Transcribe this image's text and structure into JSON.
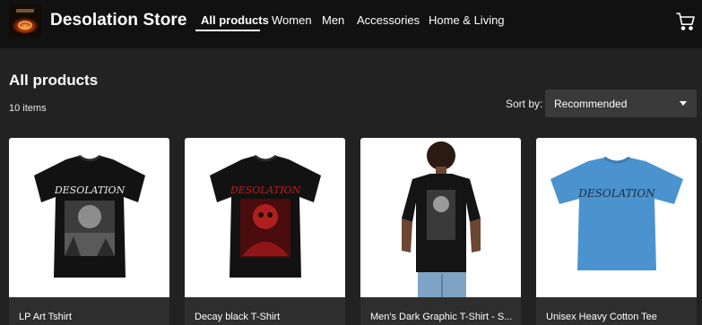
{
  "header": {
    "store_name": "Desolation Store",
    "logo_icon": "desolation-logo-icon",
    "cart_icon": "shopping-cart-icon",
    "nav": [
      {
        "label": "All products",
        "active": true
      },
      {
        "label": "Women",
        "active": false
      },
      {
        "label": "Men",
        "active": false
      },
      {
        "label": "Accessories",
        "active": false
      },
      {
        "label": "Home & Living",
        "active": false
      }
    ]
  },
  "main": {
    "title": "All products",
    "item_count": "10 items",
    "sort": {
      "label": "Sort by:",
      "value": "Recommended"
    }
  },
  "products": [
    {
      "name": "LP Art Tshirt"
    },
    {
      "name": "Decay black T-Shirt"
    },
    {
      "name": "Men's Dark Graphic T-Shirt - S..."
    },
    {
      "name": "Unisex Heavy Cotton Tee"
    }
  ],
  "colors": {
    "header_bg": "#111111",
    "page_bg": "#222222",
    "card_caption_bg": "#2e2e2e",
    "blue_tee": "#4a93cf"
  }
}
